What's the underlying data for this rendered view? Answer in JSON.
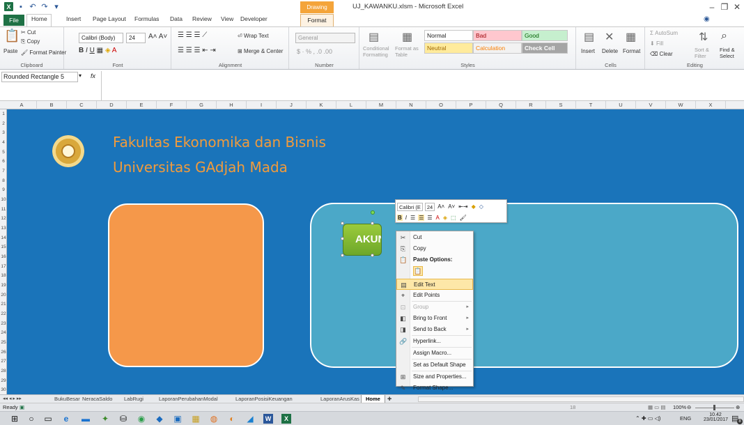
{
  "window": {
    "title": "UJ_KAWANKU.xlsm - Microsoft Excel",
    "context_tab_title": "Drawing Tools"
  },
  "ribbon_tabs": [
    "File",
    "Home",
    "Insert",
    "Page Layout",
    "Formulas",
    "Data",
    "Review",
    "View",
    "Developer",
    "Format"
  ],
  "clipboard": {
    "paste": "Paste",
    "cut": "Cut",
    "copy": "Copy",
    "format_painter": "Format Painter",
    "label": "Clipboard"
  },
  "font": {
    "name": "Calibri (Body)",
    "size": "24",
    "label": "Font"
  },
  "alignment": {
    "wrap_text": "Wrap Text",
    "merge_center": "Merge & Center",
    "label": "Alignment"
  },
  "number": {
    "format": "General",
    "label": "Number"
  },
  "styles": {
    "conditional": "Conditional Formatting",
    "format_table": "Format as Table",
    "cells": [
      "Normal",
      "Bad",
      "Good",
      "Neutral",
      "Calculation",
      "Check Cell"
    ],
    "label": "Styles"
  },
  "cells_group": {
    "insert": "Insert",
    "delete": "Delete",
    "format": "Format",
    "label": "Cells"
  },
  "editing": {
    "autosum": "AutoSum",
    "fill": "Fill",
    "clear": "Clear",
    "sort_filter": "Sort & Filter",
    "find_select": "Find & Select",
    "label": "Editing"
  },
  "formula_bar": {
    "name_box": "Rounded Rectangle 5",
    "fx": "fx"
  },
  "columns": [
    "A",
    "B",
    "C",
    "D",
    "E",
    "F",
    "G",
    "H",
    "I",
    "J",
    "K",
    "L",
    "M",
    "N",
    "O",
    "P",
    "Q",
    "R",
    "S",
    "T",
    "U",
    "V",
    "W",
    "X"
  ],
  "rows": [
    "1",
    "2",
    "3",
    "4",
    "5",
    "6",
    "7",
    "8",
    "9",
    "10",
    "11",
    "12",
    "13",
    "14",
    "15",
    "16",
    "17",
    "18",
    "19",
    "20",
    "21",
    "22",
    "23",
    "24",
    "25",
    "26",
    "27",
    "28",
    "29",
    "30"
  ],
  "sheet": {
    "heading1": "Fakultas Ekonomika dan Bisnis",
    "heading2": "Universitas GAdjah Mada",
    "akun_label": "AKUN"
  },
  "mini_toolbar": {
    "font": "Calibri (E",
    "size": "24"
  },
  "context_menu": [
    {
      "label": "Cut",
      "icon": "scissors-icon",
      "state": "normal"
    },
    {
      "label": "Copy",
      "icon": "copy-icon",
      "state": "normal"
    },
    {
      "label": "Paste Options:",
      "icon": "paste-icon",
      "state": "header"
    },
    {
      "label": "Edit Text",
      "icon": "edit-text-icon",
      "state": "highlighted"
    },
    {
      "label": "Edit Points",
      "icon": "edit-points-icon",
      "state": "normal"
    },
    {
      "label": "Group",
      "icon": "group-icon",
      "state": "disabled"
    },
    {
      "label": "Bring to Front",
      "icon": "bring-front-icon",
      "state": "normal"
    },
    {
      "label": "Send to Back",
      "icon": "send-back-icon",
      "state": "normal"
    },
    {
      "label": "Hyperlink...",
      "icon": "hyperlink-icon",
      "state": "normal"
    },
    {
      "label": "Assign Macro...",
      "icon": "",
      "state": "normal"
    },
    {
      "label": "Set as Default Shape",
      "icon": "",
      "state": "normal"
    },
    {
      "label": "Size and Properties...",
      "icon": "size-icon",
      "state": "normal"
    },
    {
      "label": "Format Shape...",
      "icon": "format-shape-icon",
      "state": "normal"
    }
  ],
  "sheet_tabs": [
    "BukuBesar",
    "NeracaSaldo",
    "LabRugi",
    "LaporanPerubahanModal",
    "LaporanPosisiKeuangan",
    "LaporanArusKas",
    "Home"
  ],
  "active_sheet": "Home",
  "status": {
    "ready": "Ready",
    "zoom": "100%",
    "page_number": "18"
  },
  "taskbar": {
    "time": "10.42",
    "date": "23/01/2017",
    "lang": "ENG",
    "notif_count": "8"
  },
  "colors": {
    "sheet_bg": "#1a74ba",
    "orange_box": "#f5984a",
    "teal_box": "#4ba8c8",
    "heading": "#f29b3b",
    "akun_btn": "#7cb530",
    "excel_green": "#1e7145"
  }
}
